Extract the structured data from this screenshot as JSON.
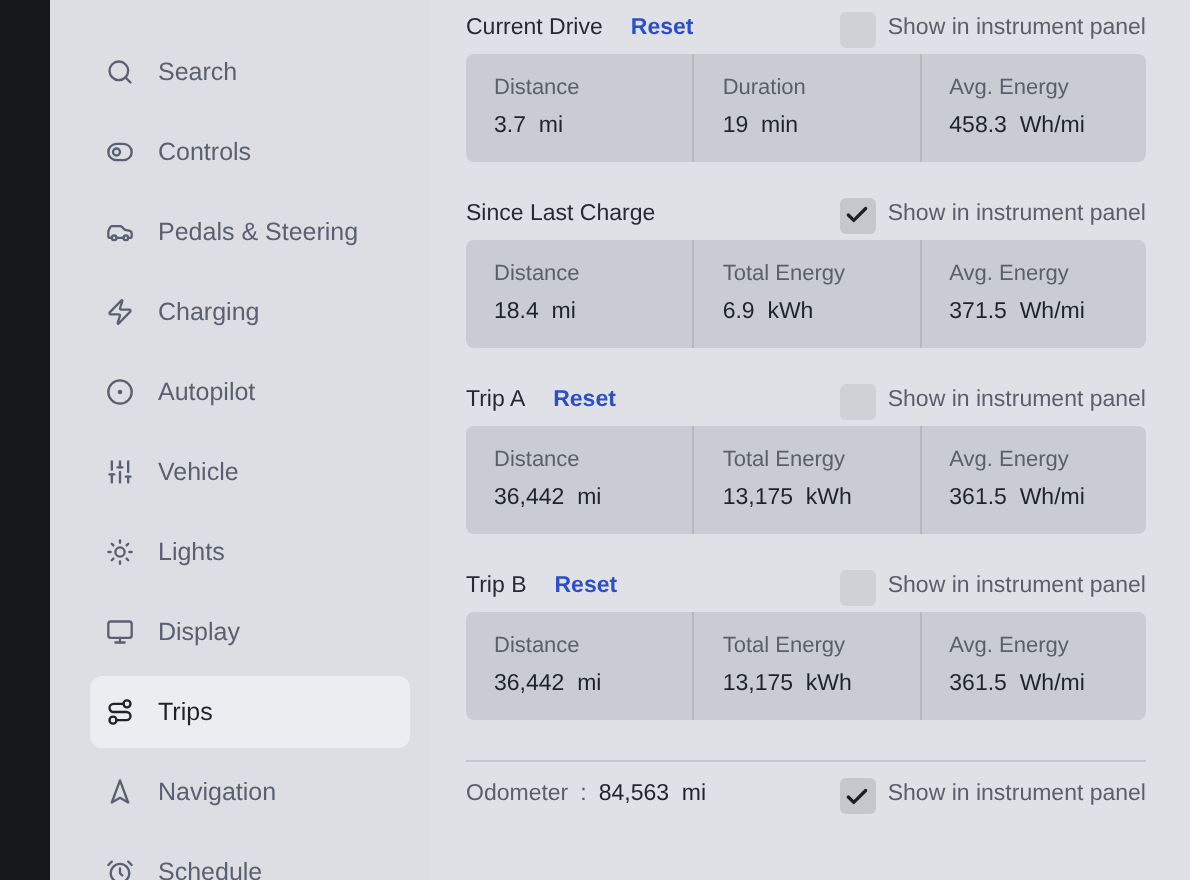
{
  "sidebar": {
    "items": [
      {
        "label": "Search",
        "selected": false
      },
      {
        "label": "Controls",
        "selected": false
      },
      {
        "label": "Pedals & Steering",
        "selected": false
      },
      {
        "label": "Charging",
        "selected": false
      },
      {
        "label": "Autopilot",
        "selected": false
      },
      {
        "label": "Vehicle",
        "selected": false
      },
      {
        "label": "Lights",
        "selected": false
      },
      {
        "label": "Display",
        "selected": false
      },
      {
        "label": "Trips",
        "selected": true
      },
      {
        "label": "Navigation",
        "selected": false
      },
      {
        "label": "Schedule",
        "selected": false
      }
    ]
  },
  "sections": [
    {
      "title": "Current Drive",
      "reset": "Reset",
      "show_label": "Show in instrument panel",
      "checked": false,
      "stats": [
        {
          "label": "Distance",
          "value": "3.7  mi"
        },
        {
          "label": "Duration",
          "value": "19  min"
        },
        {
          "label": "Avg. Energy",
          "value": "458.3  Wh/mi"
        }
      ]
    },
    {
      "title": "Since Last Charge",
      "show_label": "Show in instrument panel",
      "checked": true,
      "stats": [
        {
          "label": "Distance",
          "value": "18.4  mi"
        },
        {
          "label": "Total Energy",
          "value": "6.9  kWh"
        },
        {
          "label": "Avg. Energy",
          "value": "371.5  Wh/mi"
        }
      ]
    },
    {
      "title": "Trip A",
      "reset": "Reset",
      "show_label": "Show in instrument panel",
      "checked": false,
      "stats": [
        {
          "label": "Distance",
          "value": "36,442  mi"
        },
        {
          "label": "Total Energy",
          "value": "13,175  kWh"
        },
        {
          "label": "Avg. Energy",
          "value": "361.5  Wh/mi"
        }
      ]
    },
    {
      "title": "Trip B",
      "reset": "Reset",
      "show_label": "Show in instrument panel",
      "checked": false,
      "stats": [
        {
          "label": "Distance",
          "value": "36,442  mi"
        },
        {
          "label": "Total Energy",
          "value": "13,175  kWh"
        },
        {
          "label": "Avg. Energy",
          "value": "361.5  Wh/mi"
        }
      ]
    }
  ],
  "odometer": {
    "label": "Odometer",
    "separator": ":",
    "value": "84,563  mi",
    "show_label": "Show in instrument panel",
    "checked": true
  }
}
